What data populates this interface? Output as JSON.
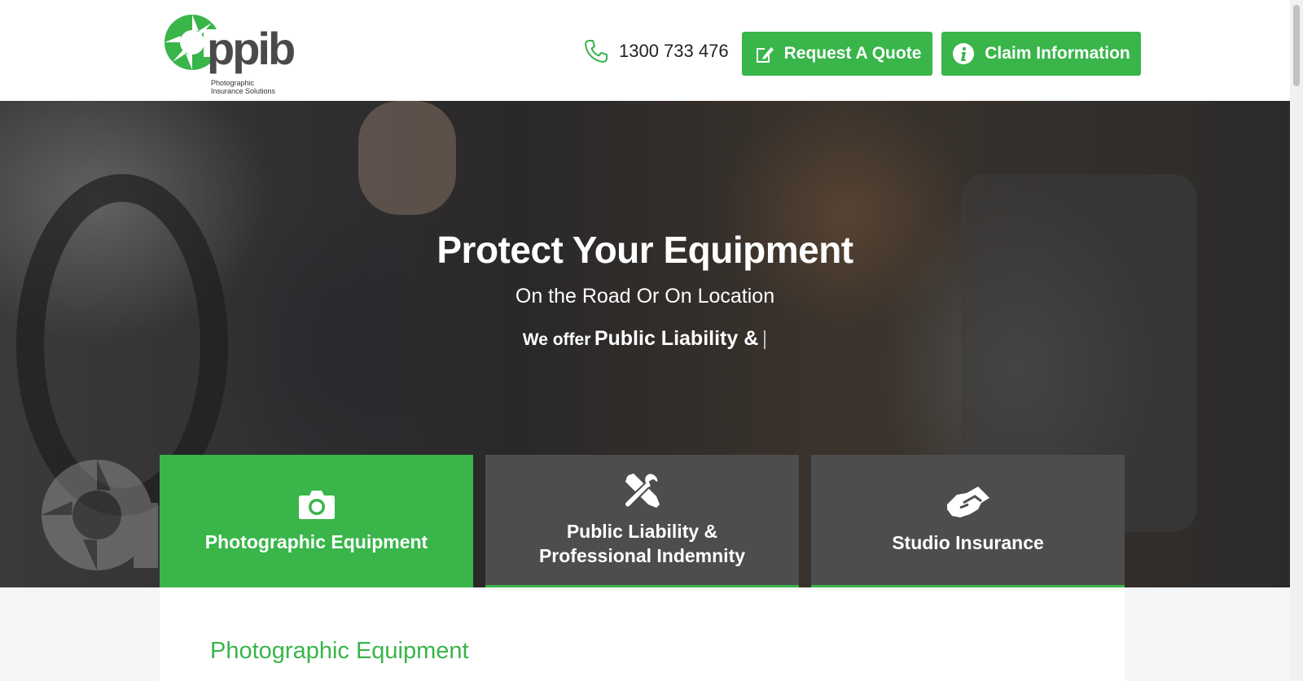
{
  "header": {
    "logo_text": "ppib",
    "logo_tagline": "Photographic Insurance Solutions",
    "phone": "1300 733 476",
    "buttons": {
      "quote_label": "Request A Quote",
      "claim_label": "Claim Information"
    }
  },
  "hero": {
    "title": "Protect Your Equipment",
    "subtitle": "On the Road Or On Location",
    "offer_prefix": "We offer",
    "offer_highlight": "Public Liability &",
    "cursor": "|"
  },
  "cards": [
    {
      "label": "Photographic Equipment",
      "icon": "camera-icon"
    },
    {
      "label": "Public Liability & Professional Indemnity",
      "icon": "tools-icon"
    },
    {
      "label": "Studio Insurance",
      "icon": "handshake-icon"
    }
  ],
  "content": {
    "section_title": "Photographic Equipment"
  },
  "colors": {
    "brand_green": "#39b54a",
    "card_gray": "#4d4d4f"
  }
}
